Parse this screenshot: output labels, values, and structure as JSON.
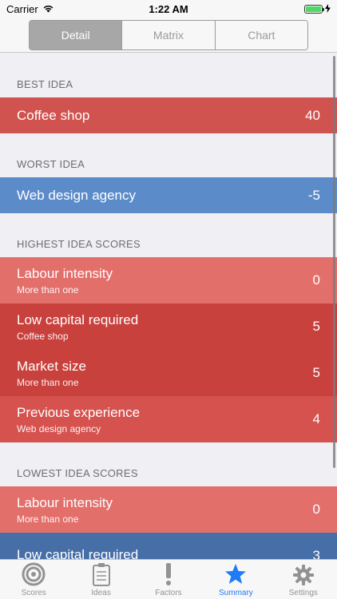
{
  "status_bar": {
    "carrier": "Carrier",
    "time": "1:22 AM"
  },
  "segmented": {
    "detail": "Detail",
    "matrix": "Matrix",
    "chart": "Chart"
  },
  "best": {
    "header": "BEST IDEA",
    "label": "Coffee shop",
    "value": "40"
  },
  "worst": {
    "header": "WORST IDEA",
    "label": "Web design agency",
    "value": "-5"
  },
  "highest": {
    "header": "HIGHEST IDEA SCORES",
    "rows": [
      {
        "label": "Labour intensity",
        "subtitle": "More than one",
        "value": "0"
      },
      {
        "label": "Low capital required",
        "subtitle": "Coffee shop",
        "value": "5"
      },
      {
        "label": "Market size",
        "subtitle": "More than one",
        "value": "5"
      },
      {
        "label": "Previous experience",
        "subtitle": "Web design agency",
        "value": "4"
      }
    ]
  },
  "lowest": {
    "header": "LOWEST IDEA SCORES",
    "rows": [
      {
        "label": "Labour intensity",
        "subtitle": "More than one",
        "value": "0"
      },
      {
        "label": "Low capital required",
        "subtitle": "",
        "value": "3"
      }
    ]
  },
  "tabs": {
    "scores": "Scores",
    "ideas": "Ideas",
    "factors": "Factors",
    "summary": "Summary",
    "settings": "Settings"
  },
  "colors": {
    "accent": "#1f7bf6",
    "best": "#d0534f",
    "worst": "#5b8cc9"
  }
}
